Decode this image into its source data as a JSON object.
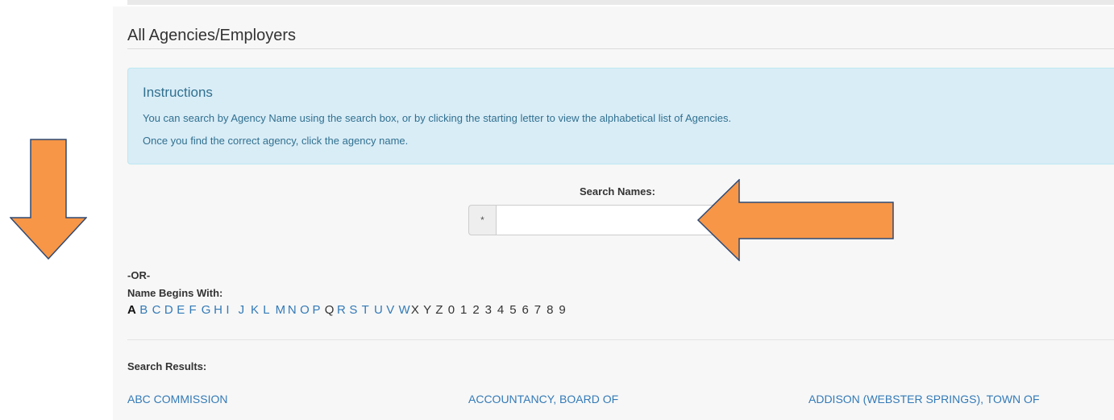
{
  "page": {
    "title": "All Agencies/Employers"
  },
  "instructions": {
    "heading": "Instructions",
    "line1": "You can search by Agency Name using the search box, or by clicking the starting letter to view the alphabetical list of Agencies.",
    "line2": "Once you find the correct agency, click the agency name."
  },
  "search": {
    "label": "Search Names:",
    "addon": "*",
    "value": ""
  },
  "browse": {
    "or_text": "-OR-",
    "begins_label": "Name Begins With:",
    "selected": "A",
    "letters": [
      "A",
      "B",
      "C",
      "D",
      "E",
      "F",
      "G",
      "H",
      "I",
      "J",
      "K",
      "L",
      "M",
      "N",
      "O",
      "P",
      "Q",
      "R",
      "S",
      "T",
      "U",
      "V",
      "W",
      "X",
      "Y",
      "Z",
      "0",
      "1",
      "2",
      "3",
      "4",
      "5",
      "6",
      "7",
      "8",
      "9"
    ],
    "inactive": [
      "Q",
      "X",
      "Y",
      "Z",
      "0",
      "1",
      "2",
      "3",
      "4",
      "5",
      "6",
      "7",
      "8",
      "9"
    ]
  },
  "results": {
    "label": "Search Results:",
    "items": [
      "ABC COMMISSION",
      "ACCOUNTANCY, BOARD OF",
      "ADDISON (WEBSTER SPRINGS), TOWN OF"
    ]
  },
  "annotations": {
    "arrow_color": "#f79646",
    "arrow_outline": "#2f4a75"
  }
}
